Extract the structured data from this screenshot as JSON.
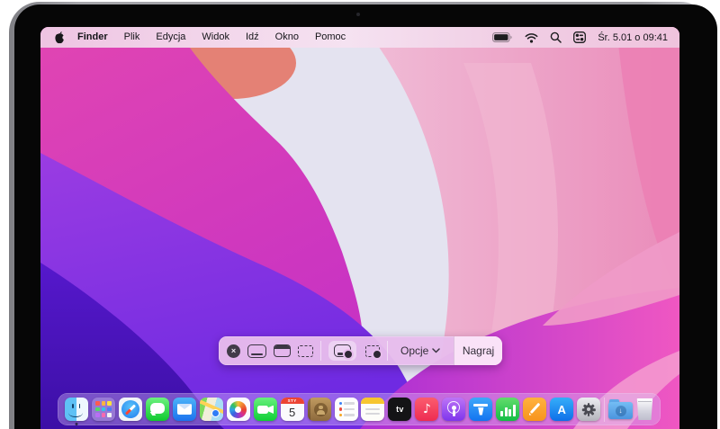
{
  "menu_bar": {
    "items": [
      {
        "label": "Finder",
        "active": true
      },
      {
        "label": "Plik"
      },
      {
        "label": "Edycja"
      },
      {
        "label": "Widok"
      },
      {
        "label": "Idź"
      },
      {
        "label": "Okno"
      },
      {
        "label": "Pomoc"
      }
    ],
    "status_icons": [
      "battery-icon",
      "wifi-icon",
      "search-icon",
      "control-center-icon"
    ],
    "clock": "Śr. 5.01 o 09:41"
  },
  "screenshot_toolbar": {
    "close_label": "×",
    "tools": [
      {
        "name": "capture-entire-screen",
        "selected": false
      },
      {
        "name": "capture-selected-window",
        "selected": false
      },
      {
        "name": "capture-selected-portion",
        "selected": false
      },
      {
        "name": "record-entire-screen",
        "selected": true
      },
      {
        "name": "record-selected-portion",
        "selected": false
      }
    ],
    "options_label": "Opcje",
    "record_button_label": "Nagraj"
  },
  "dock": {
    "apps": [
      "finder",
      "launchpad",
      "safari",
      "messages",
      "mail",
      "maps",
      "photos",
      "facetime",
      "calendar",
      "contacts",
      "reminders",
      "notes",
      "tv",
      "music",
      "podcasts",
      "keynote",
      "numbers",
      "pages",
      "app-store",
      "system-preferences",
      "downloads",
      "trash"
    ],
    "running_app": "finder",
    "calendar": {
      "month": "STY",
      "day": "5"
    },
    "tv_label": "tv",
    "music_glyph": "♪",
    "appstore_label": "A",
    "downloads_glyph": "↓"
  },
  "colors": {
    "menu_bar_pink": "#f2d4ec",
    "toolbar_lavender": "#e7bcec",
    "record_segment_pink": "#fae3f8",
    "wallpaper_magenta": "#d63aa0",
    "wallpaper_purple": "#7a2bd8",
    "wallpaper_violet": "#4c16bc",
    "wallpaper_light": "#e4e3f0"
  }
}
